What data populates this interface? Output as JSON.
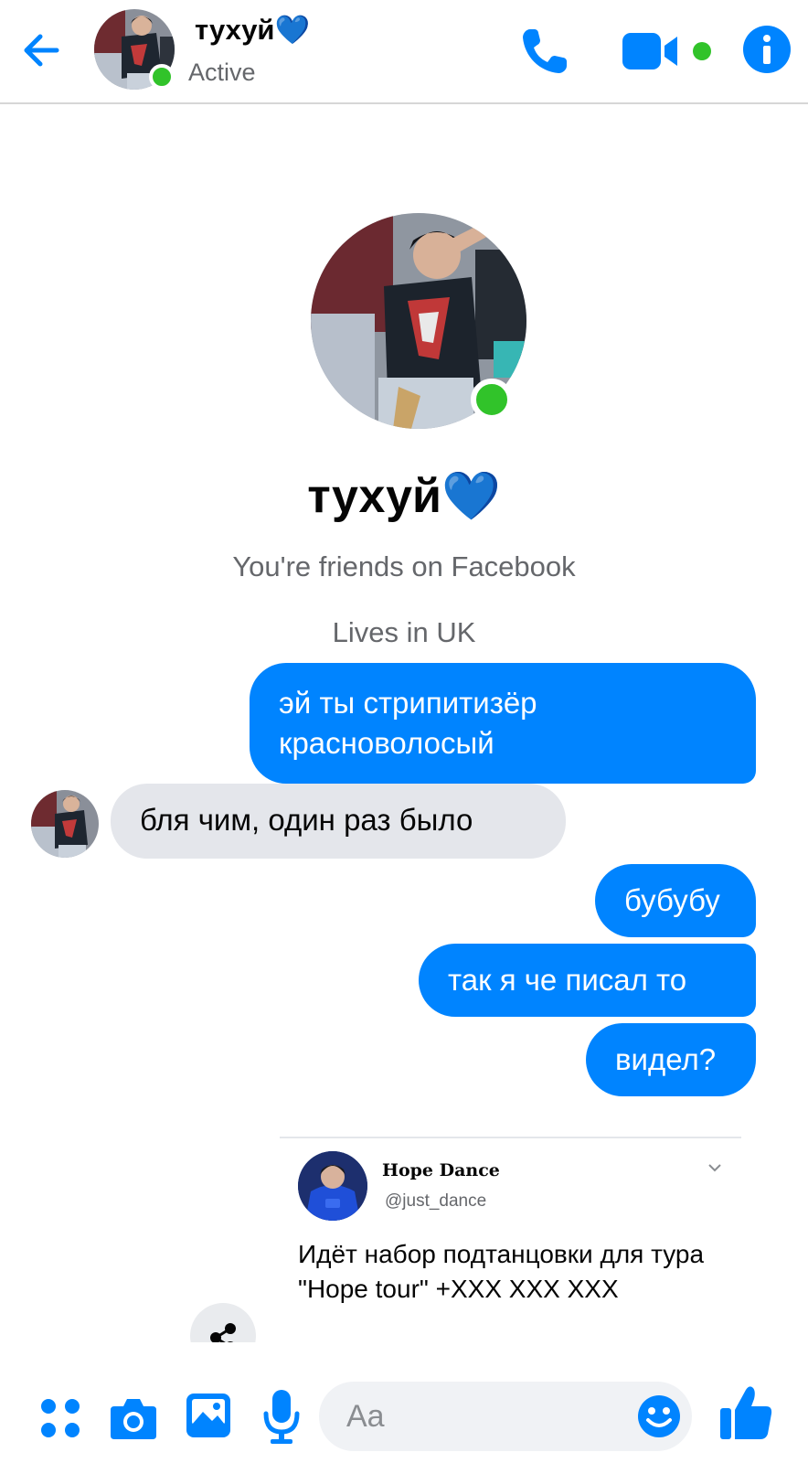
{
  "header": {
    "contact_name": "тухуй💙",
    "status": "Active",
    "icons": [
      "back-arrow-icon",
      "phone-icon",
      "video-camera-icon",
      "info-icon"
    ]
  },
  "profile": {
    "name": "тухуй💙",
    "friends_text": "You're friends on Facebook",
    "lives_text": "Lives in UK"
  },
  "messages": [
    {
      "direction": "outgoing",
      "text": "эй ты стрипитизёр красноволосый"
    },
    {
      "direction": "incoming",
      "text": "бля чим, один раз было"
    },
    {
      "direction": "outgoing",
      "text": "бубубу"
    },
    {
      "direction": "outgoing",
      "text": "так я че писал то"
    },
    {
      "direction": "outgoing",
      "text": "видел?"
    }
  ],
  "shared_post": {
    "author_name": "Hope Dance",
    "author_handle": "@just_dance",
    "text": "Идёт набор подтанцовки для тура \"Hope tour\" +XXX XXX XXX"
  },
  "composer": {
    "placeholder": "Aa",
    "icons": [
      "apps-icon",
      "camera-icon",
      "image-icon",
      "microphone-icon",
      "emoji-icon",
      "thumbs-up-icon"
    ]
  },
  "colors": {
    "accent": "#0084ff",
    "active": "#31c32a",
    "incoming_bubble": "#e4e6eb"
  }
}
